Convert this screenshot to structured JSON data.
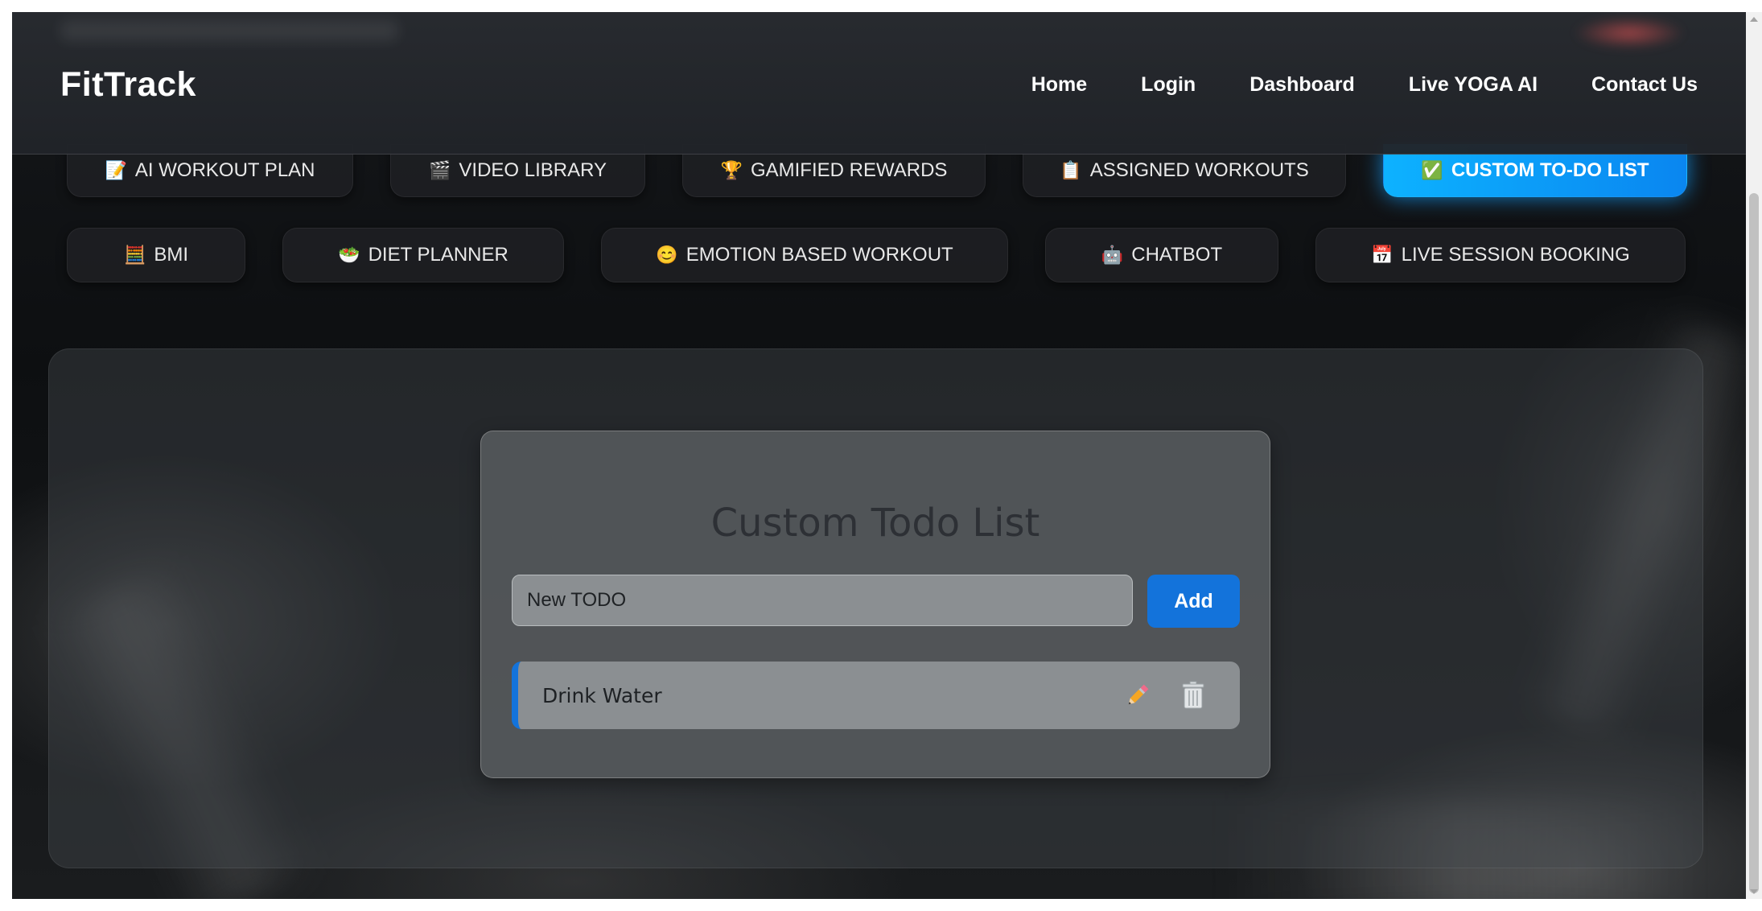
{
  "navbar": {
    "brand": "FitTrack",
    "links": [
      "Home",
      "Login",
      "Dashboard",
      "Live YOGA AI",
      "Contact Us"
    ]
  },
  "features": {
    "row1": [
      {
        "icon": "📝",
        "label": "AI WORKOUT PLAN"
      },
      {
        "icon": "🎬",
        "label": "VIDEO LIBRARY"
      },
      {
        "icon": "🏆",
        "label": "GAMIFIED REWARDS"
      },
      {
        "icon": "📋",
        "label": "ASSIGNED WORKOUTS"
      },
      {
        "icon": "✅",
        "label": "CUSTOM TO-DO LIST"
      }
    ],
    "row2": [
      {
        "icon": "🧮",
        "label": "BMI"
      },
      {
        "icon": "🥗",
        "label": "DIET PLANNER"
      },
      {
        "icon": "😊",
        "label": "EMOTION BASED WORKOUT"
      },
      {
        "icon": "🤖",
        "label": "CHATBOT"
      },
      {
        "icon": "📅",
        "label": "LIVE SESSION BOOKING"
      }
    ],
    "active": "CUSTOM TO-DO LIST"
  },
  "todo": {
    "title": "Custom Todo List",
    "input_placeholder": "New TODO",
    "add_label": "Add",
    "items": [
      {
        "text": "Drink Water"
      }
    ]
  },
  "colors": {
    "accent": "#1373db",
    "active_tab": "#0db2ff",
    "navbar_bg": "#282b30"
  },
  "icons": {
    "edit": "pencil-icon",
    "delete": "trash-icon"
  }
}
